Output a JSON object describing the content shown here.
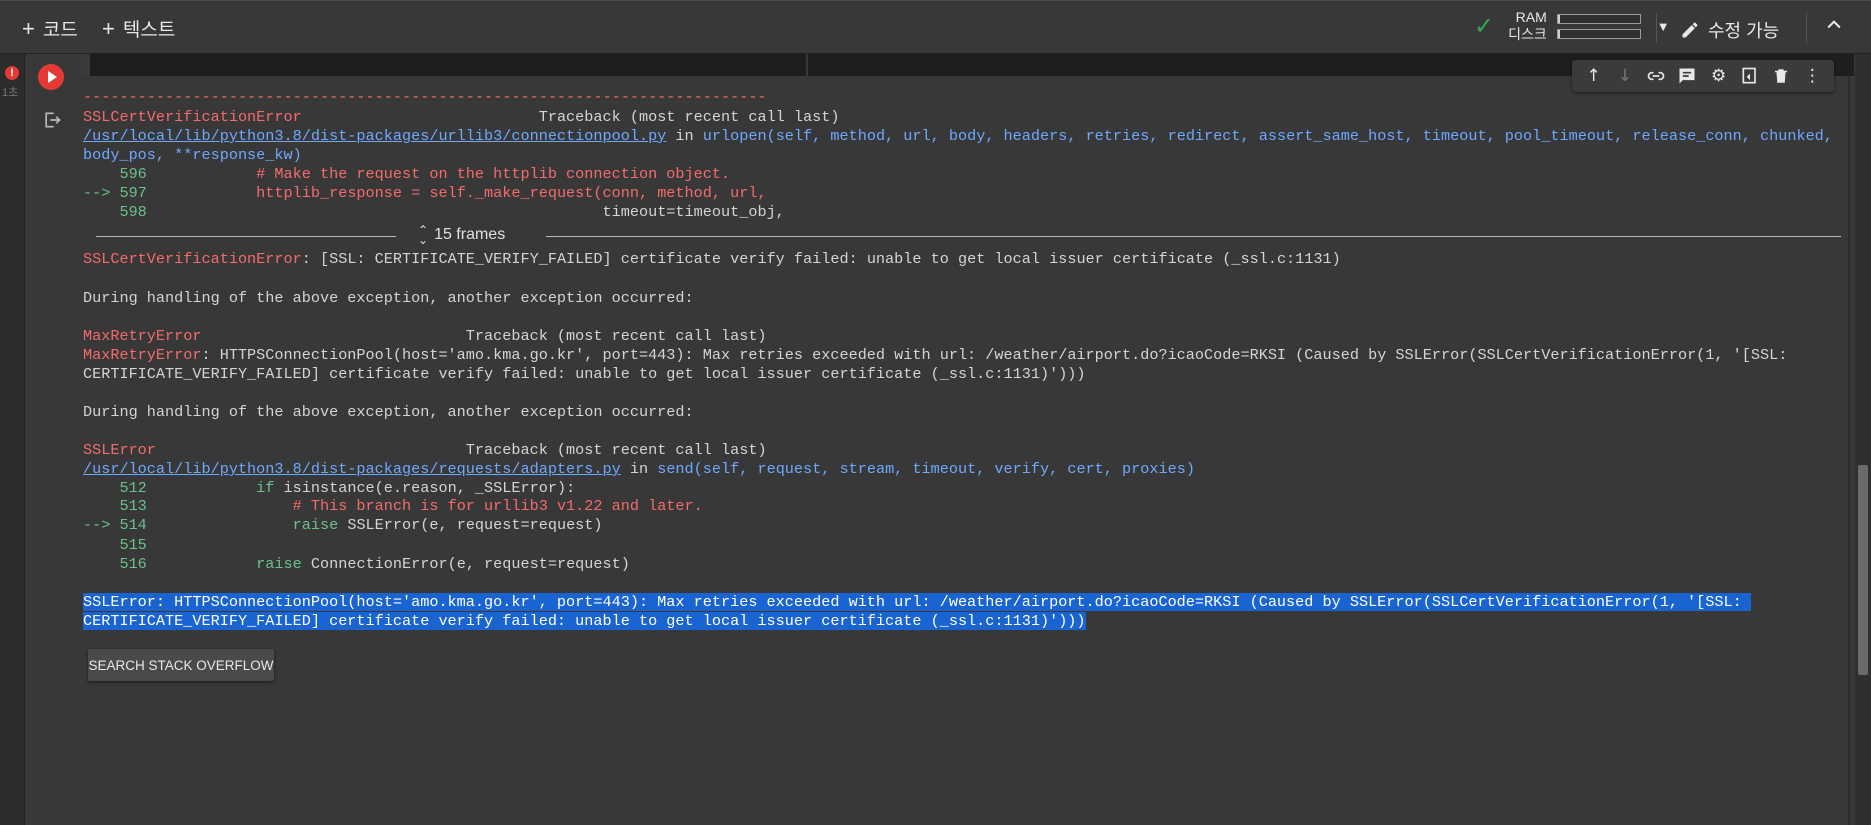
{
  "toolbar": {
    "add_code": "코드",
    "add_text": "텍스트",
    "ram_label": "RAM",
    "disk_label": "디스크",
    "ram_usage": 0.03,
    "disk_usage": 0.03,
    "edit_label": "수정 가능"
  },
  "gutter": {
    "error_badge": "!",
    "time": "1초"
  },
  "output": {
    "dash_line": "---------------------------------------------------------------------------",
    "tb1_error": "SSLCertVerificationError",
    "tb1_header": "                          Traceback (most recent call last)",
    "tb1_path": "/usr/local/lib/python3.8/dist-packages/urllib3/connectionpool.py",
    "tb1_in": " in ",
    "tb1_func": "urlopen",
    "tb1_args": "(self, method, url, body, headers, retries, redirect, assert_same_host, timeout, pool_timeout, release_conn, chunked,",
    "tb1_args2": "body_pos, **response_kw)",
    "tb1_l596_num": "    596",
    "tb1_l596_code": "            # Make the request on the httplib connection object.",
    "tb1_l597_arrow": "--> 597",
    "tb1_l597_code": "            httplib_response = self._make_request(conn, method, url,",
    "tb1_l598_num": "    598",
    "tb1_l598_code": "                                                  timeout=timeout_obj,",
    "frames_label": "15 frames",
    "err1_name": "SSLCertVerificationError",
    "err1_msg": ": [SSL: CERTIFICATE_VERIFY_FAILED] certificate verify failed: unable to get local issuer certificate (_ssl.c:1131)",
    "during1": "During handling of the above exception, another exception occurred:",
    "tb2_error": "MaxRetryError",
    "tb2_header": "                             Traceback (most recent call last)",
    "err2_name": "MaxRetryError",
    "err2_msg": ": HTTPSConnectionPool(host='amo.kma.go.kr', port=443): Max retries exceeded with url: /weather/airport.do?icaoCode=RKSI (Caused by SSLError(SSLCertVerificationError(1, '[SSL:",
    "err2_msg2": "CERTIFICATE_VERIFY_FAILED] certificate verify failed: unable to get local issuer certificate (_ssl.c:1131)')))",
    "during2": "During handling of the above exception, another exception occurred:",
    "tb3_error": "SSLError",
    "tb3_header": "                                  Traceback (most recent call last)",
    "tb3_path": "/usr/local/lib/python3.8/dist-packages/requests/adapters.py",
    "tb3_in": " in ",
    "tb3_func": "send",
    "tb3_args": "(self, request, stream, timeout, verify, cert, proxies)",
    "l512_num": "    512",
    "l512_kw": "            if",
    "l512_code": " isinstance(e.reason, _SSLError):",
    "l513_num": "    513",
    "l513_code": "                # This branch is for urllib3 v1.22 and later.",
    "l514_arrow": "--> 514",
    "l514_kw": "                raise",
    "l514_code": " SSLError(e, request=request)",
    "l515_num": "    515",
    "l516_num": "    516",
    "l516_kw": "            raise",
    "l516_code": " ConnectionError(e, request=request)",
    "final1": "SSLError: HTTPSConnectionPool(host='amo.kma.go.kr', port=443): Max retries exceeded with url: /weather/airport.do?icaoCode=RKSI (Caused by SSLError(SSLCertVerificationError(1, '[SSL: ",
    "final2": "CERTIFICATE_VERIFY_FAILED] certificate verify failed: unable to get local issuer certificate (_ssl.c:1131)')))",
    "so_button": "SEARCH STACK OVERFLOW"
  }
}
